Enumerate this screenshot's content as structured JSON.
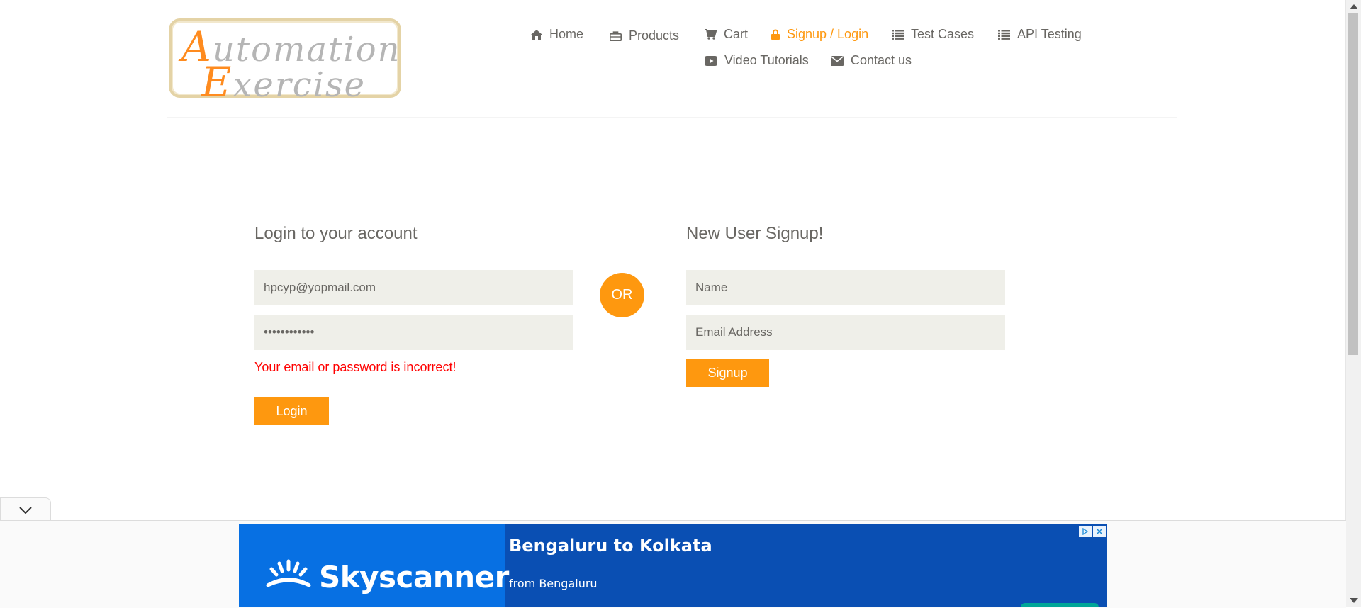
{
  "logo": {
    "line1_cap": "A",
    "line1_rest": "utomation",
    "line2_cap": "E",
    "line2_rest": "xercise"
  },
  "nav": {
    "home": "Home",
    "products": "Products",
    "cart": "Cart",
    "signup_login": "Signup / Login",
    "test_cases": "Test Cases",
    "api_testing": "API Testing",
    "video_tutorials": "Video Tutorials",
    "contact_us": "Contact us"
  },
  "login": {
    "heading": "Login to your account",
    "email_value": "hpcyp@yopmail.com",
    "password_value": "••••••••••••",
    "error": "Your email or password is incorrect!",
    "button": "Login"
  },
  "or_label": "OR",
  "signup": {
    "heading": "New User Signup!",
    "name_placeholder": "Name",
    "email_placeholder": "Email Address",
    "button": "Signup"
  },
  "ad": {
    "brand": "Skyscanner",
    "title": "Bengaluru to Kolkata",
    "subtitle": "from Bengaluru"
  },
  "colors": {
    "accent": "#fe980f",
    "error": "#ff0000",
    "field_bg": "#efefe9",
    "ad_blue": "#0770e3"
  }
}
